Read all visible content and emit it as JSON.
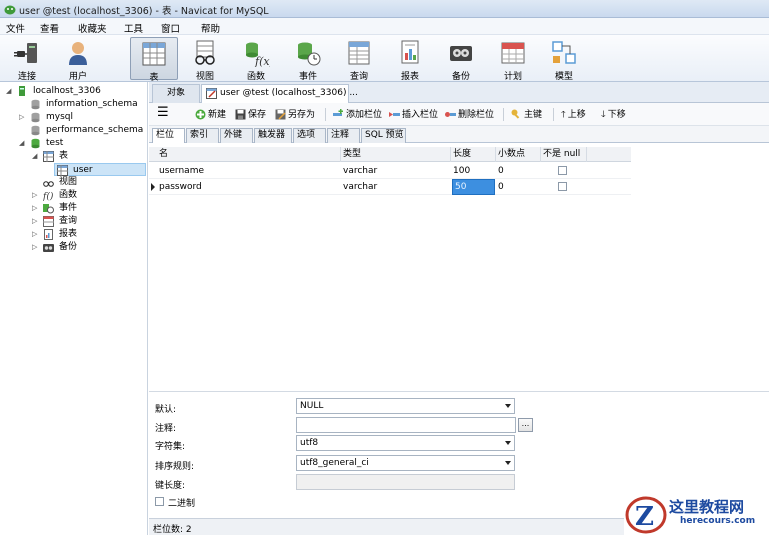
{
  "window": {
    "title": "user @test (localhost_3306) - 表 - Navicat for MySQL"
  },
  "menu": [
    "文件",
    "查看",
    "收藏夹",
    "工具",
    "窗口",
    "帮助"
  ],
  "toolbar": {
    "buttons": [
      {
        "label": "连接",
        "icon": "plug-icon"
      },
      {
        "label": "用户",
        "icon": "user-icon"
      },
      {
        "label": "表",
        "icon": "table-icon",
        "active": true
      },
      {
        "label": "视图",
        "icon": "view-glasses-icon"
      },
      {
        "label": "函数",
        "icon": "function-icon"
      },
      {
        "label": "事件",
        "icon": "event-clock-icon"
      },
      {
        "label": "查询",
        "icon": "query-icon"
      },
      {
        "label": "报表",
        "icon": "report-icon"
      },
      {
        "label": "备份",
        "icon": "backup-icon"
      },
      {
        "label": "计划",
        "icon": "calendar-icon"
      },
      {
        "label": "模型",
        "icon": "model-icon"
      }
    ]
  },
  "tree": {
    "connection": "localhost_3306",
    "databases": [
      "information_schema",
      "mysql",
      "performance_schema",
      "test"
    ],
    "test_children": {
      "tables_label": "表",
      "selected_table": "user",
      "views": "视图",
      "functions": "函数",
      "events": "事件",
      "queries": "查询",
      "reports": "报表",
      "backups": "备份"
    }
  },
  "object_tabs": {
    "objects": "对象",
    "current": "user @test (localhost_3306) ..."
  },
  "edit_toolbar": {
    "new": "新建",
    "save": "保存",
    "save_as": "另存为",
    "add_field": "添加栏位",
    "insert_field": "插入栏位",
    "delete_field": "删除栏位",
    "primary_key": "主键",
    "move_up": "上移",
    "move_down": "下移"
  },
  "design_tabs": [
    "栏位",
    "索引",
    "外键",
    "触发器",
    "选项",
    "注释",
    "SQL 预览"
  ],
  "grid": {
    "columns": [
      "名",
      "类型",
      "长度",
      "小数点",
      "不是 null"
    ],
    "rows": [
      {
        "name": "username",
        "type": "varchar",
        "length": "100",
        "decimals": "0"
      },
      {
        "name": "password",
        "type": "varchar",
        "length": "50",
        "decimals": "0"
      }
    ]
  },
  "properties": {
    "default_label": "默认:",
    "default_value": "NULL",
    "comment_label": "注释:",
    "comment_value": "",
    "comment_button": "...",
    "charset_label": "字符集:",
    "charset_value": "utf8",
    "collation_label": "排序规则:",
    "collation_value": "utf8_general_ci",
    "keylen_label": "键长度:",
    "keylen_value": "",
    "binary_label": "二进制"
  },
  "status": {
    "field_count": "栏位数: 2"
  },
  "watermark": {
    "text_cn": "这里教程网",
    "text_en": "herecours.com"
  },
  "colors": {
    "accent": "#3d8fe0",
    "selected_row": "#cce4f7",
    "db_green": "#3f9a3a"
  }
}
